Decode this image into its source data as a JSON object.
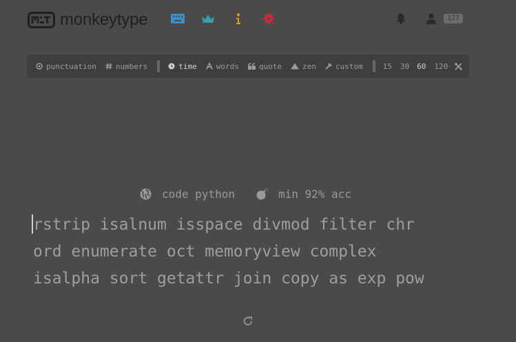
{
  "header": {
    "logo_text": "monkeytype",
    "nav_icons": [
      {
        "name": "keyboard-icon",
        "color": "#3b8fc4"
      },
      {
        "name": "crown-icon",
        "color": "#33a3b0"
      },
      {
        "name": "info-icon",
        "color": "#d4a01c"
      },
      {
        "name": "gear-icon",
        "color": "#d4263c"
      }
    ],
    "notifications_icon": "bell-icon",
    "account_icon": "user-icon",
    "level_badge": "127"
  },
  "config": {
    "toggles": [
      {
        "label": "punctuation",
        "icon": "at-icon"
      },
      {
        "label": "numbers",
        "icon": "hash-icon"
      }
    ],
    "modes": [
      {
        "label": "time",
        "icon": "clock-icon",
        "active": true
      },
      {
        "label": "words",
        "icon": "font-icon",
        "active": false
      },
      {
        "label": "quote",
        "icon": "quote-icon",
        "active": false
      },
      {
        "label": "zen",
        "icon": "mountain-icon",
        "active": false
      },
      {
        "label": "custom",
        "icon": "wrench-icon",
        "active": false
      }
    ],
    "durations": [
      {
        "label": "15",
        "active": false
      },
      {
        "label": "30",
        "active": false
      },
      {
        "label": "60",
        "active": true
      },
      {
        "label": "120",
        "active": false
      }
    ],
    "custom_duration_icon": "tools-icon"
  },
  "info": {
    "language": "code python",
    "language_icon": "globe-icon",
    "min_acc": "min 92% acc",
    "min_acc_icon": "bomb-icon"
  },
  "words": {
    "lines": [
      "rstrip isalnum isspace divmod filter chr",
      "ord enumerate oct memoryview complex",
      "isalpha sort getattr join copy as exp pow"
    ]
  },
  "restart_icon": "redo-icon"
}
